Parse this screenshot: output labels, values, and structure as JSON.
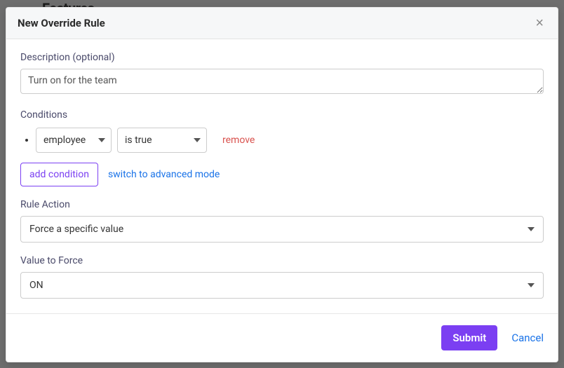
{
  "backdrop": {
    "heading_fragment": "Features"
  },
  "modal": {
    "title": "New Override Rule",
    "close_symbol": "×"
  },
  "description": {
    "label": "Description (optional)",
    "value": "Turn on for the team"
  },
  "conditions": {
    "label": "Conditions",
    "rows": [
      {
        "attribute": "employee",
        "operator": "is true"
      }
    ],
    "remove_label": "remove",
    "add_button": "add condition",
    "advanced_link": "switch to advanced mode"
  },
  "rule_action": {
    "label": "Rule Action",
    "selected": "Force a specific value"
  },
  "value_to_force": {
    "label": "Value to Force",
    "selected": "ON"
  },
  "footer": {
    "submit": "Submit",
    "cancel": "Cancel"
  }
}
